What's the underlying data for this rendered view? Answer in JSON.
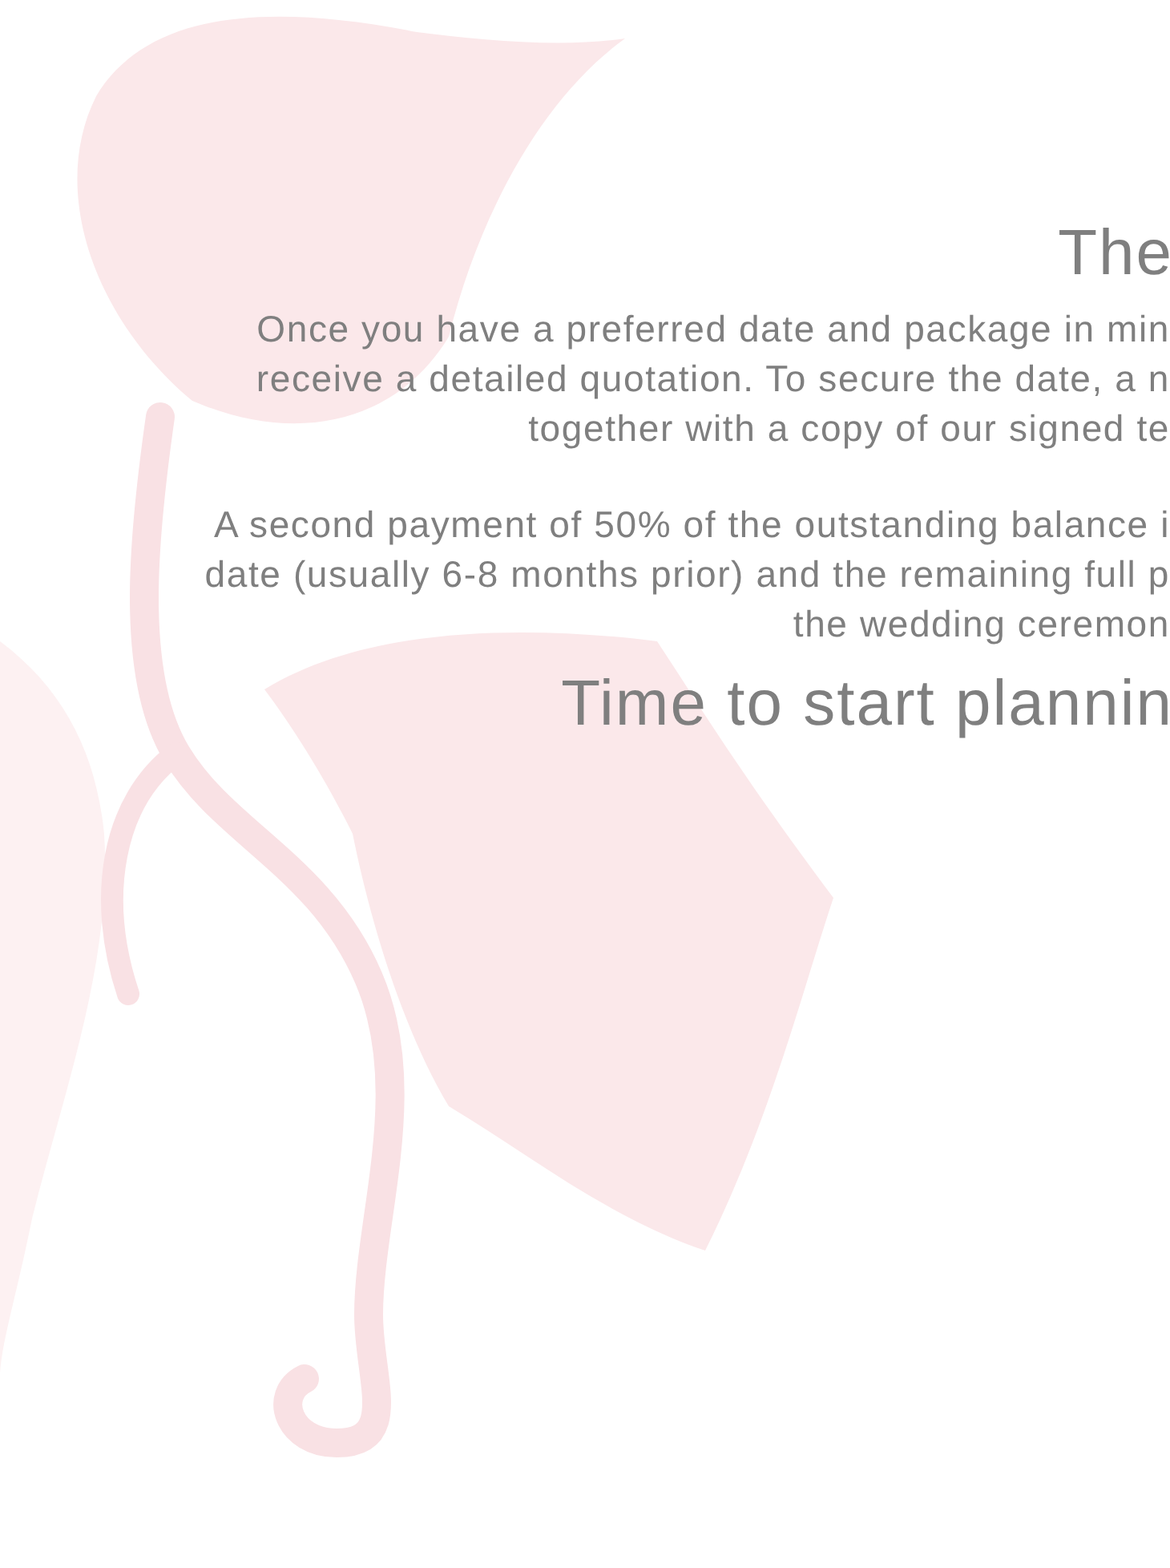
{
  "sections": [
    {
      "heading": "The",
      "paragraphs": [
        [
          "Once you have a preferred date and package in min",
          "receive a detailed quotation. To secure the date, a n",
          "together with a copy of our signed te"
        ],
        [
          "A second payment of 50% of the outstanding balance i",
          "date (usually 6-8 months prior) and the remaining full p",
          "the wedding ceremon"
        ]
      ]
    },
    {
      "heading": "Time to start plannin"
    }
  ]
}
